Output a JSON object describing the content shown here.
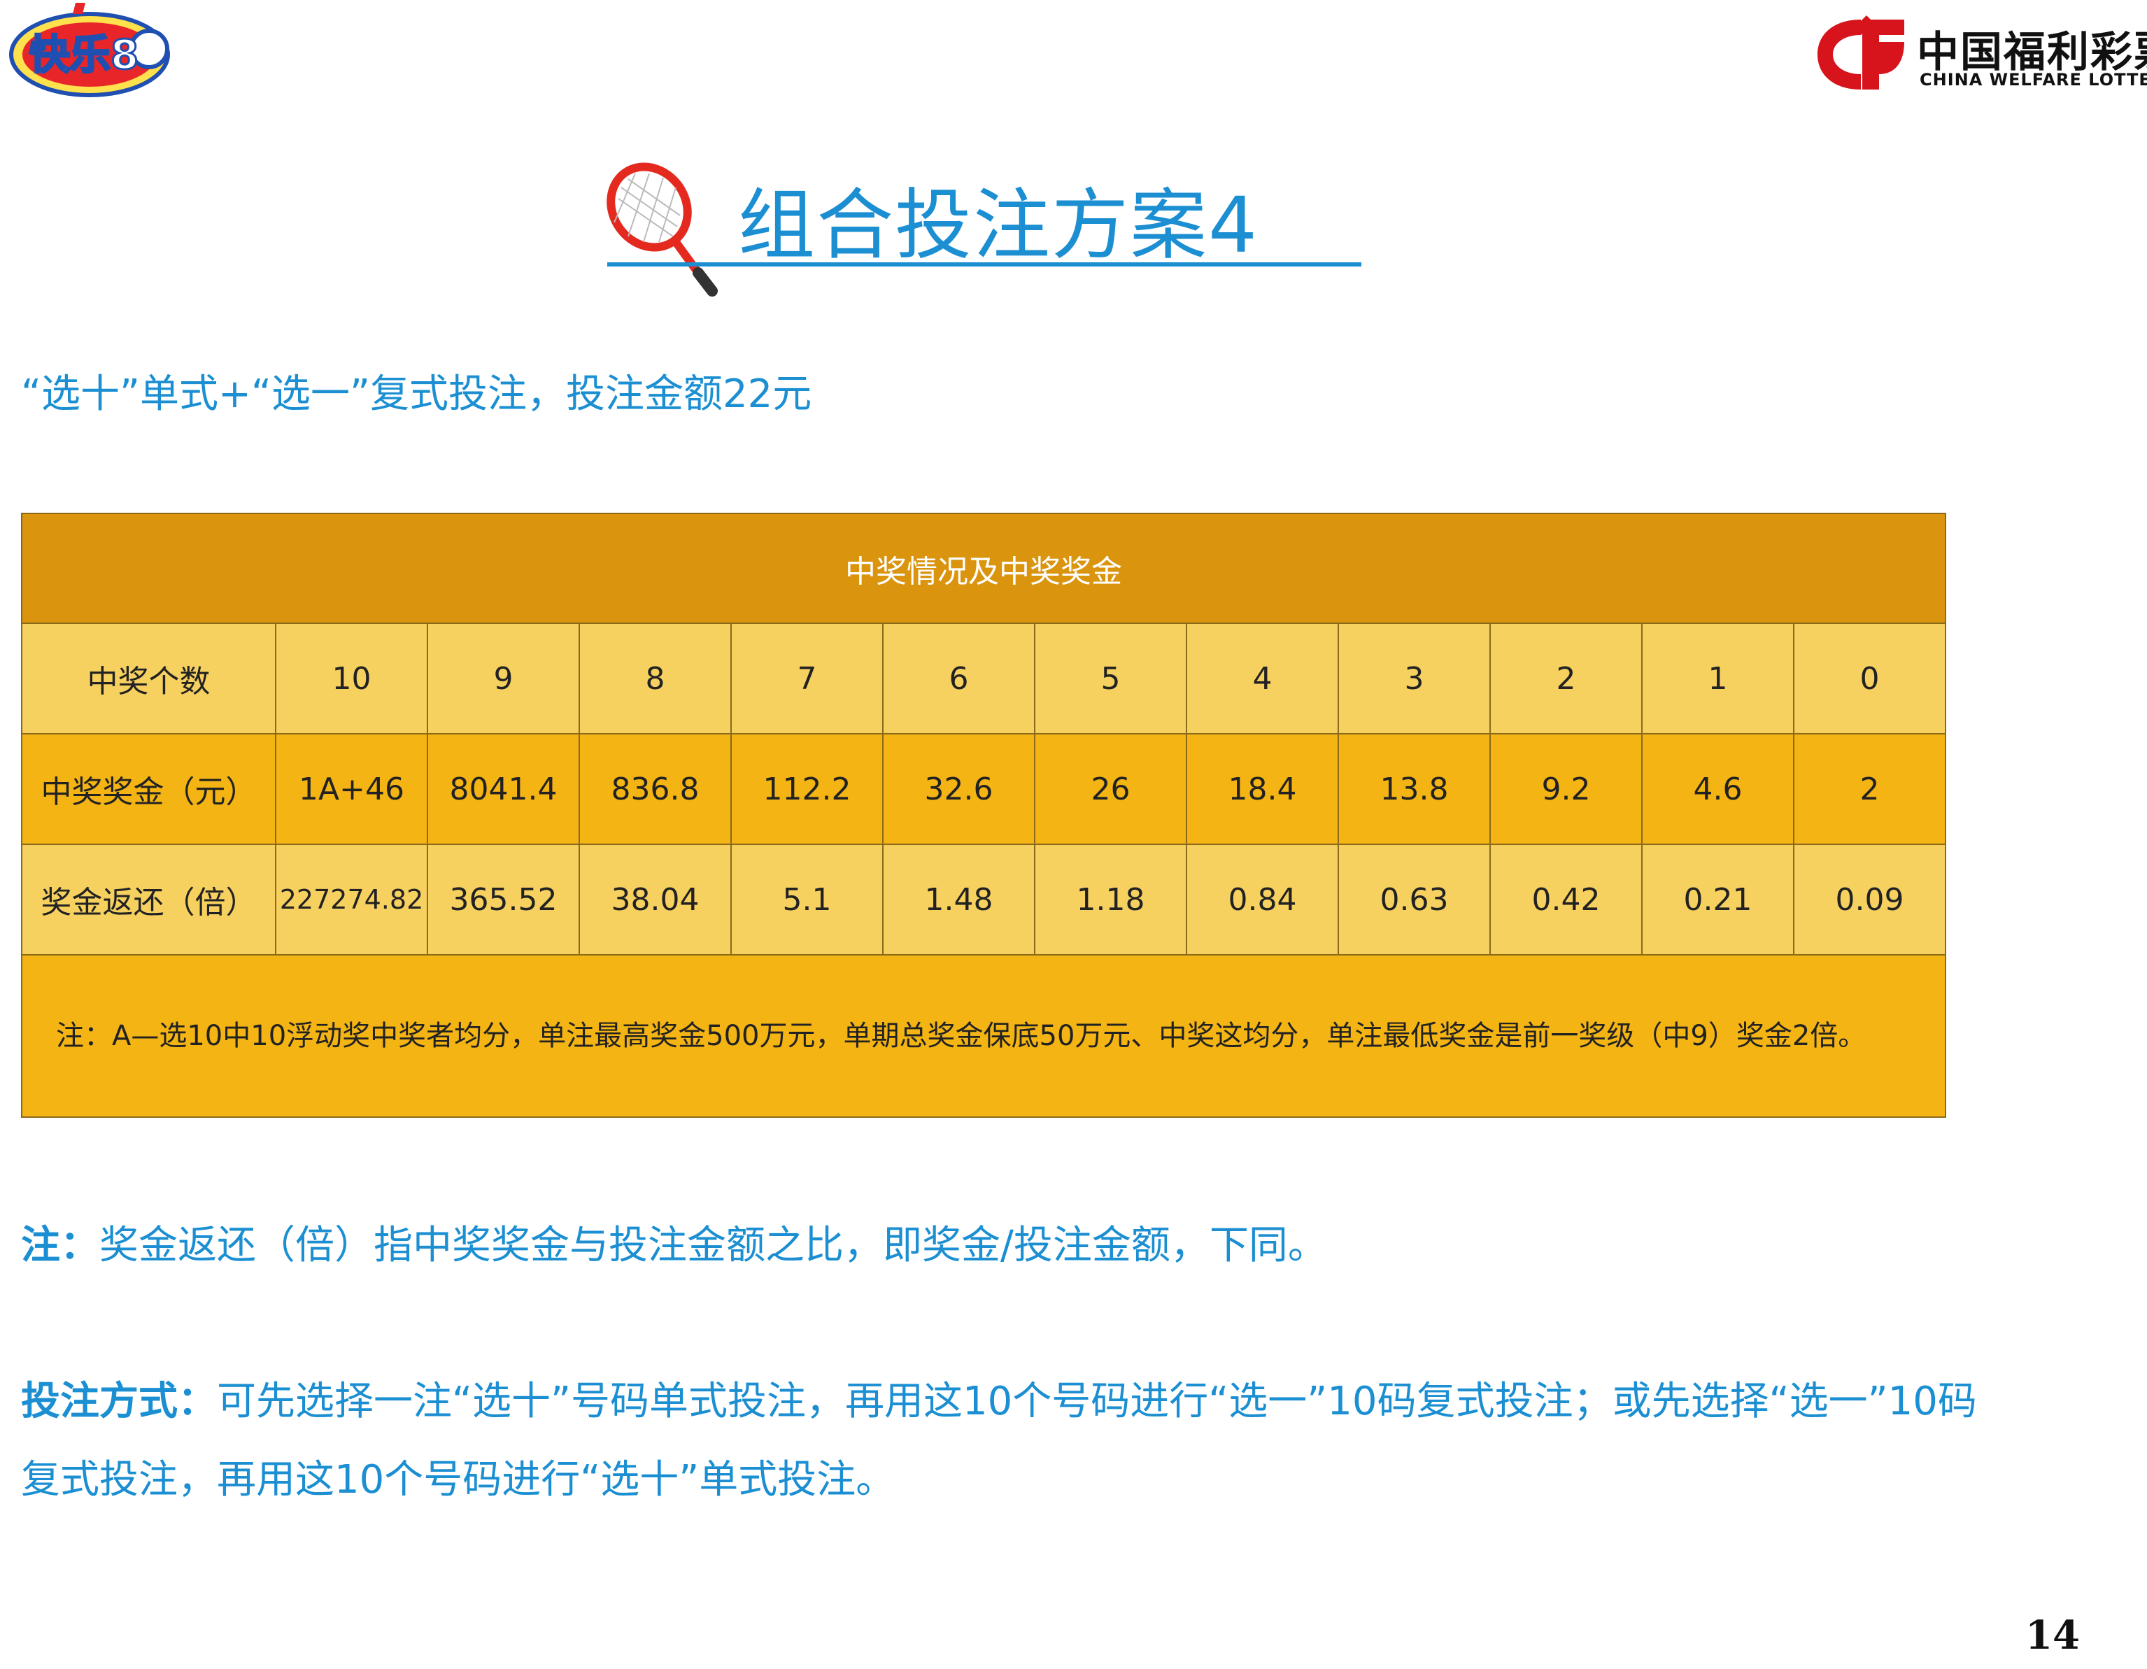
{
  "logos": {
    "left_text": "快乐8",
    "right_cn": "中国福利彩票",
    "right_en": "CHINA WELFARE LOTTERY"
  },
  "title": "组合投注方案4",
  "subtitle": "“选十”单式+“选一”复式投注，投注金额22元",
  "table": {
    "header": "中奖情况及中奖奖金",
    "rows": [
      {
        "label": "中奖个数",
        "cells": [
          "10",
          "9",
          "8",
          "7",
          "6",
          "5",
          "4",
          "3",
          "2",
          "1",
          "0"
        ]
      },
      {
        "label": "中奖奖金（元）",
        "cells": [
          "1A+46",
          "8041.4",
          "836.8",
          "112.2",
          "32.6",
          "26",
          "18.4",
          "13.8",
          "9.2",
          "4.6",
          "2"
        ]
      },
      {
        "label": "奖金返还（倍）",
        "cells": [
          "227274.82",
          "365.52",
          "38.04",
          "5.1",
          "1.48",
          "1.18",
          "0.84",
          "0.63",
          "0.42",
          "0.21",
          "0.09"
        ]
      }
    ],
    "note": "注：A—选10中10浮动奖中奖者均分，单注最高奖金500万元，单期总奖金保底50万元、中奖这均分，单注最低奖金是前一奖级（中9）奖金2倍。"
  },
  "note1": {
    "label": "注：",
    "text": "奖金返还（倍）指中奖奖金与投注金额之比，即奖金/投注金额，下同。"
  },
  "method": {
    "label": "投注方式：",
    "text": "可先选择一注“选十”号码单式投注，再用这10个号码进行“选一”10码复式投注；或先选择“选一”10码复式投注，再用这10个号码进行“选十”单式投注。"
  },
  "page_number": "14",
  "colors": {
    "accent_blue": "#1b8fd2",
    "table_header": "#da940e",
    "row_light": "#f7d160",
    "row_dark": "#f4b414"
  }
}
